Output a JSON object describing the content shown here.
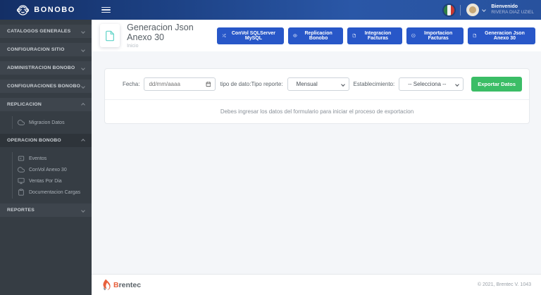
{
  "navbar": {
    "brand": "BONOBO",
    "welcome_label": "Bienvenido",
    "user_name": "RIVERA DIAZ UZIEL"
  },
  "sidebar": {
    "sections": [
      {
        "label": "CATALOGOS GENERALES",
        "state": "collapsed"
      },
      {
        "label": "CONFIGURACION SITIO",
        "state": "collapsed"
      },
      {
        "label": "ADMINISTRACION BONOBO",
        "state": "collapsed"
      },
      {
        "label": "CONFIGURACIONES BONOBO",
        "state": "collapsed"
      },
      {
        "label": "REPLICACION",
        "state": "expanded",
        "children": [
          {
            "label": "Migracion Datos",
            "icon": "cloud-icon"
          }
        ]
      },
      {
        "label": "OPERACION BONOBO",
        "state": "expanded",
        "children": [
          {
            "label": "Eventos",
            "icon": "window-icon"
          },
          {
            "label": "ConVol Anexo 30",
            "icon": "cloud-icon"
          },
          {
            "label": "Ventas Por Dia",
            "icon": "monitor-icon"
          },
          {
            "label": "Documentacion Cargas",
            "icon": "clipboard-icon"
          }
        ]
      },
      {
        "label": "REPORTES",
        "state": "collapsed"
      }
    ]
  },
  "page_header": {
    "title": "Generacion Json Anexo 30",
    "breadcrumb": "Inicio",
    "title_icon": "file-icon",
    "actions": [
      {
        "label": "ConVol SQLServer MySQL",
        "icon": "shuffle-icon"
      },
      {
        "label": "Replicacion Bonobo",
        "icon": "eye-icon"
      },
      {
        "label": "Integracion Facturas",
        "icon": "file-icon"
      },
      {
        "label": "Importacion Facturas",
        "icon": "minus-circle-icon"
      },
      {
        "label": "Generacion Json Anexo 30",
        "icon": "file-icon"
      }
    ]
  },
  "form": {
    "fecha_label": "Fecha:",
    "fecha_placeholder": "dd/mm/aaaa",
    "tipo_label": "tipo de dato:Tipo reporte:",
    "tipo_value": "Mensual",
    "establecimiento_label": "Establecimiento:",
    "establecimiento_value": "-- Selecciona --",
    "export_button": "Exportar Datos",
    "helper_text": "Debes ingresar los datos del formulario para iniciar el proceso de exportacion"
  },
  "footer": {
    "brand_initial": "B",
    "brand_rest": "rentec",
    "copyright": "© 2021, Brentec V. 1043"
  },
  "colors": {
    "accent_blue": "#2857c8",
    "accent_green": "#3bbd66",
    "teal_icon": "#5fd3c7",
    "sidebar_bg": "#363d44",
    "navbar_start": "#142f66",
    "navbar_end": "#2a57a7"
  }
}
